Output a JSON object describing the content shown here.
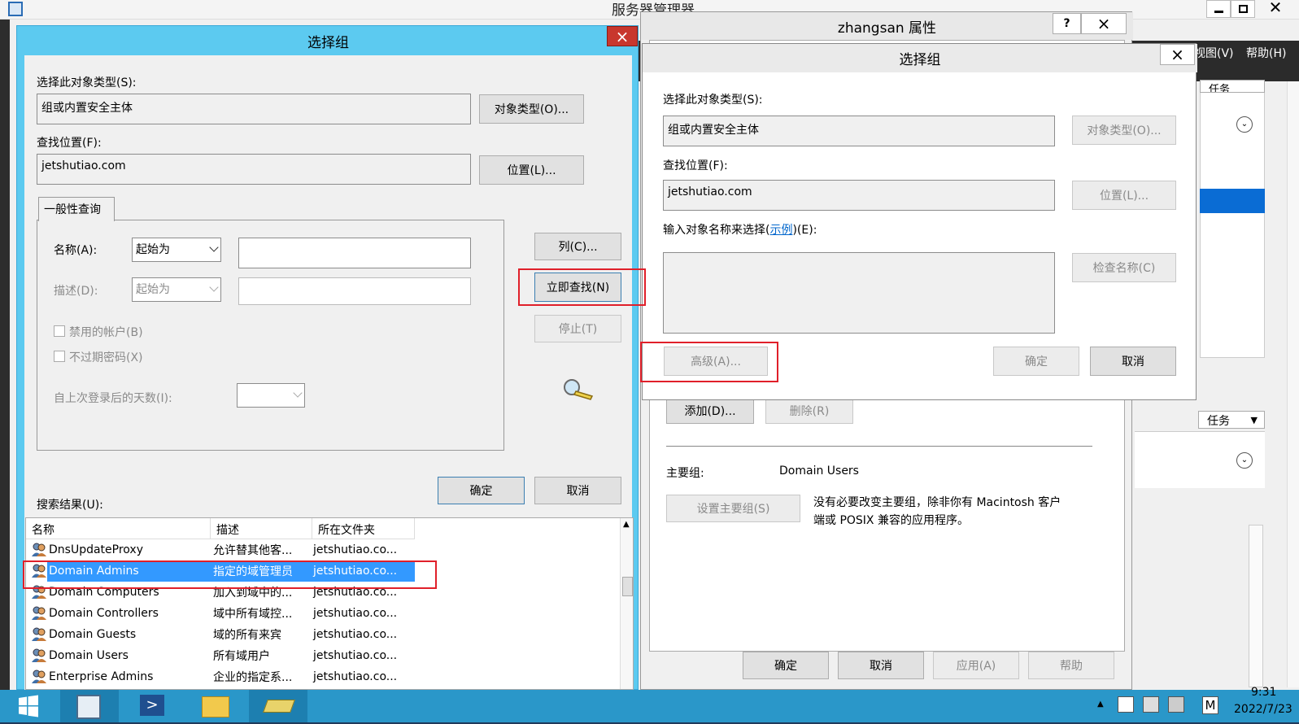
{
  "server_manager": {
    "title": "服务器管理器",
    "menu_view": "视图(V)",
    "menu_help": "帮助(H)",
    "tasks1": "任务",
    "tasks2": "任务"
  },
  "props": {
    "title": "zhangsan 属性",
    "help": "?",
    "close": "×",
    "add": "添加(D)...",
    "remove": "删除(R)",
    "primary_group_label": "主要组:",
    "primary_group_value": "Domain Users",
    "set_primary": "设置主要组(S)",
    "note_line1": "没有必要改变主要组，除非你有 Macintosh 客户",
    "note_line2": "端或 POSIX 兼容的应用程序。",
    "ok": "确定",
    "cancel": "取消",
    "apply": "应用(A)",
    "help_btn": "帮助"
  },
  "sg_right": {
    "title": "选择组",
    "close": "×",
    "object_type_label": "选择此对象类型(S):",
    "object_type_value": "组或内置安全主体",
    "object_type_btn": "对象类型(O)...",
    "location_label": "查找位置(F):",
    "location_value": "jetshutiao.com",
    "location_btn": "位置(L)...",
    "enter_label_pre": "输入对象名称来选择(",
    "enter_label_link": "示例",
    "enter_label_post": ")(E):",
    "check_names": "检查名称(C)",
    "advanced": "高级(A)...",
    "ok": "确定",
    "cancel": "取消"
  },
  "sg_left": {
    "title": "选择组",
    "close": "×",
    "object_type_label": "选择此对象类型(S):",
    "object_type_value": "组或内置安全主体",
    "object_type_btn": "对象类型(O)...",
    "location_label": "查找位置(F):",
    "location_value": "jetshutiao.com",
    "location_btn": "位置(L)...",
    "tab": "一般性查询",
    "name_label": "名称(A):",
    "name_combo": "起始为",
    "desc_label": "描述(D):",
    "desc_combo": "起始为",
    "disabled_accounts": "禁用的帐户(B)",
    "non_expiring": "不过期密码(X)",
    "days_since_login": "自上次登录后的天数(I):",
    "columns_btn": "列(C)...",
    "find_now_btn": "立即查找(N)",
    "stop_btn": "停止(T)",
    "ok": "确定",
    "cancel": "取消",
    "results_label": "搜索结果(U):",
    "col_name": "名称",
    "col_desc": "描述",
    "col_folder": "所在文件夹",
    "rows": [
      {
        "name": "DnsUpdateProxy",
        "desc": "允许替其他客...",
        "folder": "jetshutiao.co..."
      },
      {
        "name": "Domain Admins",
        "desc": "指定的域管理员",
        "folder": "jetshutiao.co..."
      },
      {
        "name": "Domain Computers",
        "desc": "加入到域中的...",
        "folder": "jetshutiao.co..."
      },
      {
        "name": "Domain Controllers",
        "desc": "域中所有域控...",
        "folder": "jetshutiao.co..."
      },
      {
        "name": "Domain Guests",
        "desc": "域的所有来宾",
        "folder": "jetshutiao.co..."
      },
      {
        "name": "Domain Users",
        "desc": "所有域用户",
        "folder": "jetshutiao.co..."
      },
      {
        "name": "Enterprise Admins",
        "desc": "企业的指定系...",
        "folder": "jetshutiao.co..."
      }
    ],
    "selected_row": 1
  },
  "taskbar": {
    "time": "9:31",
    "date": "2022/7/23",
    "ime": "M"
  }
}
